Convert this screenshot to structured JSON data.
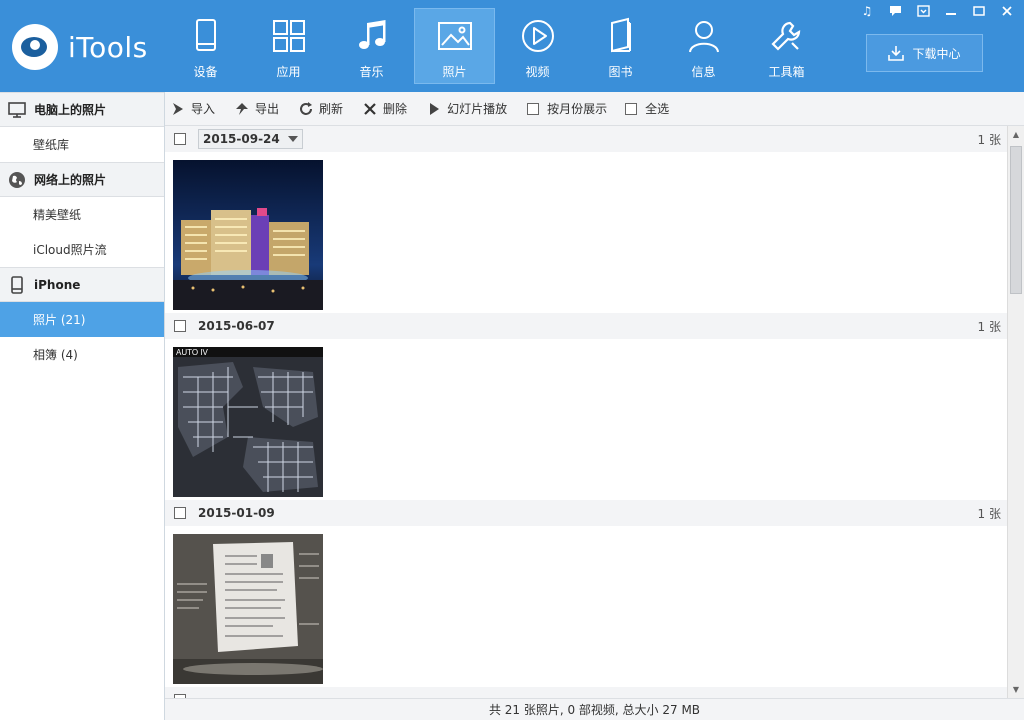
{
  "app": {
    "name": "iTools"
  },
  "nav": [
    {
      "label": "设备",
      "icon": "device-icon"
    },
    {
      "label": "应用",
      "icon": "apps-icon"
    },
    {
      "label": "音乐",
      "icon": "music-icon"
    },
    {
      "label": "照片",
      "icon": "photo-icon",
      "active": true
    },
    {
      "label": "视频",
      "icon": "video-icon"
    },
    {
      "label": "图书",
      "icon": "book-icon"
    },
    {
      "label": "信息",
      "icon": "contact-icon"
    },
    {
      "label": "工具箱",
      "icon": "wrench-icon"
    }
  ],
  "download_center": {
    "label": "下载中心"
  },
  "sidebar": {
    "sections": [
      {
        "title": "电脑上的照片",
        "icon": "monitor-icon",
        "items": [
          "壁纸库"
        ]
      },
      {
        "title": "网络上的照片",
        "icon": "globe-icon",
        "items": [
          "精美壁纸",
          "iCloud照片流"
        ]
      },
      {
        "title": "iPhone",
        "icon": "phone-icon",
        "items": [
          "照片 (21)",
          "相簿 (4)"
        ]
      }
    ],
    "active_item": "照片 (21)"
  },
  "toolbar": {
    "import": "导入",
    "export": "导出",
    "refresh": "刷新",
    "delete": "删除",
    "slideshow": "幻灯片播放",
    "by_month": "按月份展示",
    "select_all": "全选"
  },
  "groups": [
    {
      "date": "2015-09-24",
      "count": "1 张",
      "photo": "hotel-night-photo"
    },
    {
      "date": "2015-06-07",
      "count": "1 张",
      "photo": "game-map-photo"
    },
    {
      "date": "2015-01-09",
      "count": "1 张",
      "photo": "document-screen-photo"
    }
  ],
  "status": {
    "text": "共 21 张照片, 0 部视频, 总大小 27 MB"
  },
  "colors": {
    "topbar": "#3a8fd9",
    "active_nav": "#5aa7e6",
    "sidebar_active": "#4ea2e6"
  }
}
